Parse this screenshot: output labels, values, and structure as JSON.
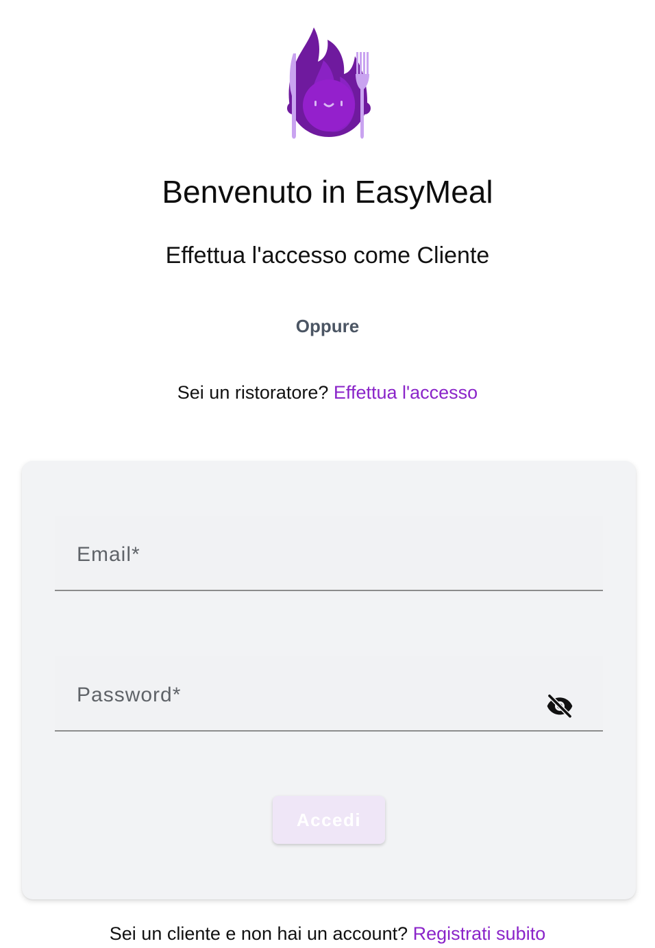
{
  "header": {
    "title": "Benvenuto in EasyMeal",
    "subtitle": "Effettua l'accesso come Cliente",
    "or_label": "Oppure",
    "restaurant_prompt": "Sei un ristoratore?",
    "restaurant_link": "Effettua l'accesso"
  },
  "logo": {
    "icon": "flame-mascot-with-cutlery-icon",
    "colors": {
      "flame_dark": "#6f1a9e",
      "flame_main": "#8a22c4",
      "face": "#9b2ed0",
      "cutlery": "#c9a3f0"
    }
  },
  "form": {
    "email_label": "Email*",
    "password_label": "Password*",
    "visibility_icon": "eye-off-icon",
    "submit_label": "Accedi"
  },
  "footer": {
    "signup_prompt": "Sei un cliente e non hai un account?",
    "signup_link": "Registrati subito"
  },
  "colors": {
    "accent": "#8a24c9",
    "card_background": "#f2f3f5",
    "button_background_disabled": "#efe6f7",
    "muted_text": "#4b5563"
  }
}
